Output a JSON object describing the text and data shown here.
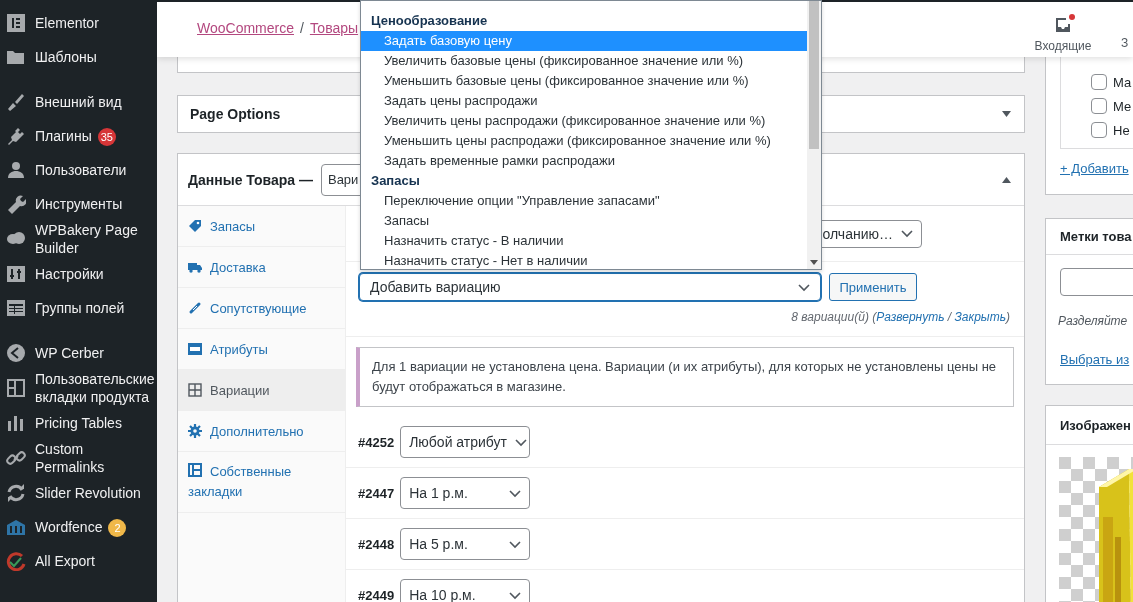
{
  "admin_menu": [
    {
      "items": [
        {
          "label": "Elementor"
        },
        {
          "label": "Шаблоны"
        }
      ]
    },
    {
      "items": [
        {
          "label": "Внешний вид"
        },
        {
          "label": "Плагины",
          "badge": {
            "text": "35",
            "color": "#d63638"
          }
        },
        {
          "label": "Пользователи"
        },
        {
          "label": "Инструменты"
        },
        {
          "label": "WPBakery Page Builder"
        },
        {
          "label": "Настройки"
        },
        {
          "label": "Группы полей"
        }
      ]
    },
    {
      "items": [
        {
          "label": "WP Cerber"
        },
        {
          "label": "Пользовательские вкладки продукта"
        },
        {
          "label": "Pricing Tables"
        },
        {
          "label": "Custom Permalinks"
        },
        {
          "label": "Slider Revolution"
        },
        {
          "label": "Wordfence",
          "badge": {
            "text": "2",
            "color": "#f0b849"
          }
        },
        {
          "label": "All Export"
        }
      ]
    }
  ],
  "header": {
    "breadcrumbs": [
      {
        "label": "WooCommerce"
      },
      {
        "label": "Товары"
      }
    ],
    "separator": "/",
    "inbox": {
      "label": "Входящие",
      "unread": true
    },
    "cut_label": "З"
  },
  "page_options": {
    "title": "Page Options",
    "expanded": false
  },
  "product_data": {
    "title": "Данные Товара —",
    "type_select": "Вари",
    "expanded": true,
    "tabs": [
      {
        "label": "Запасы",
        "selected": false
      },
      {
        "label": "Доставка",
        "selected": false
      },
      {
        "label": "Сопутствующие",
        "selected": false
      },
      {
        "label": "Атрибуты",
        "selected": false
      },
      {
        "label": "Вариации",
        "selected": true
      },
      {
        "label": "Дополнительно",
        "selected": false
      },
      {
        "label": "Собственные закладки",
        "selected": false
      }
    ],
    "default_select": "олчанию…",
    "bulk_select": "Добавить вариацию",
    "apply_button": "Применить",
    "count_line": {
      "text": "8 вариации(й) (",
      "links": [
        "Развернуть",
        "Закрыть"
      ],
      "separator": " / ",
      "end": ")"
    },
    "notice": "Для 1 вариации не установлена цена. Вариации (и их атрибуты), для которых не установлены цены не будут отображаться в магазине.",
    "variations": [
      {
        "id": "#4252",
        "value": "Любой атрибут"
      },
      {
        "id": "#2447",
        "value": "На 1 р.м."
      },
      {
        "id": "#2448",
        "value": "На 5 р.м."
      },
      {
        "id": "#2449",
        "value": "На 10 р.м."
      }
    ]
  },
  "bulk_dropdown": {
    "items": [
      {
        "kind": "group",
        "label": "Ценообразование"
      },
      {
        "kind": "option",
        "label": "Задать базовую цену",
        "selected": true
      },
      {
        "kind": "option",
        "label": "Увеличить базовые цены (фиксированное значение или %)",
        "selected": false
      },
      {
        "kind": "option",
        "label": "Уменьшить базовые цены (фиксированное значение или %)",
        "selected": false
      },
      {
        "kind": "option",
        "label": "Задать цены распродажи",
        "selected": false
      },
      {
        "kind": "option",
        "label": "Увеличить цены распродажи (фиксированное значение или %)",
        "selected": false
      },
      {
        "kind": "option",
        "label": "Уменьшить цены распродажи (фиксированное значение или %)",
        "selected": false
      },
      {
        "kind": "option",
        "label": "Задать временные рамки распродажи",
        "selected": false
      },
      {
        "kind": "group",
        "label": "Запасы"
      },
      {
        "kind": "option",
        "label": "Переключение опции \"Управление запасами\"",
        "selected": false
      },
      {
        "kind": "option",
        "label": "Запасы",
        "selected": false
      },
      {
        "kind": "option",
        "label": "Назначить статус - В наличии",
        "selected": false
      },
      {
        "kind": "option",
        "label": "Назначить статус - Нет в наличии",
        "selected": false
      }
    ]
  },
  "categories": {
    "items": [
      {
        "label": "Ма",
        "checked": false
      },
      {
        "label": "Ме",
        "checked": false
      },
      {
        "label": "Не",
        "checked": false
      }
    ],
    "add_link": "+ Добавить"
  },
  "tags": {
    "title": "Метки това",
    "hint": "Разделяйте",
    "choose_link": "Выбрать из"
  },
  "image": {
    "title": "Изображен",
    "kind": "picture"
  }
}
